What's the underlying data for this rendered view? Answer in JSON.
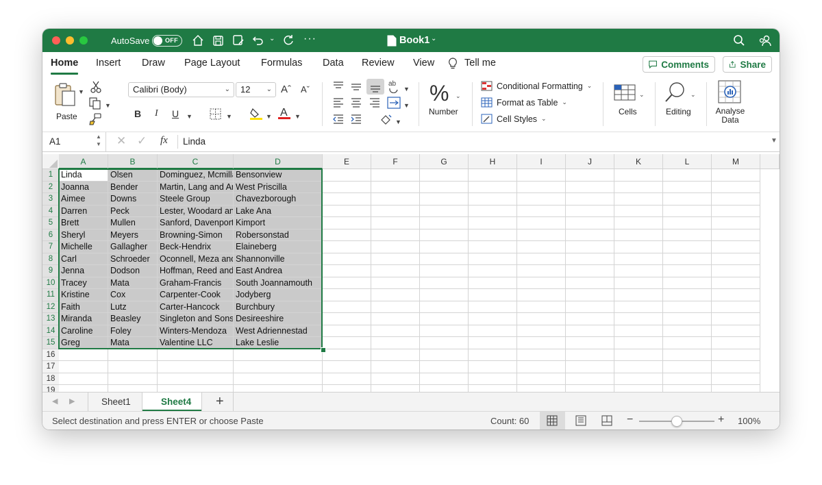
{
  "titlebar": {
    "autosave_label": "AutoSave",
    "toggle_label": "OFF",
    "doc_title": "Book1",
    "more": "···"
  },
  "tabs": [
    "Home",
    "Insert",
    "Draw",
    "Page Layout",
    "Formulas",
    "Data",
    "Review",
    "View"
  ],
  "tell_me": "Tell me",
  "comments_label": "Comments",
  "share_label": "Share",
  "ribbon": {
    "paste_label": "Paste",
    "font_name": "Calibri (Body)",
    "font_size": "12",
    "bold": "B",
    "italic": "I",
    "underline": "U",
    "number_label": "Number",
    "number_icon": "%",
    "cond_format": "Conditional Formatting",
    "format_table": "Format as Table",
    "cell_styles": "Cell Styles",
    "cells_label": "Cells",
    "editing_label": "Editing",
    "analyse_label": "Analyse",
    "analyse_label2": "Data"
  },
  "formula_bar": {
    "name_box": "A1",
    "fx": "fx",
    "value": "Linda"
  },
  "columns": [
    "A",
    "B",
    "C",
    "D",
    "E",
    "F",
    "G",
    "H",
    "I",
    "J",
    "K",
    "L",
    "M"
  ],
  "rows": [
    [
      "Linda",
      "Olsen",
      "Dominguez, Mcmillan and Donovan",
      "Bensonview"
    ],
    [
      "Joanna",
      "Bender",
      "Martin, Lang and Andrade",
      "West Priscilla"
    ],
    [
      "Aimee",
      "Downs",
      "Steele Group",
      "Chavezborough"
    ],
    [
      "Darren",
      "Peck",
      "Lester, Woodard and Mitchell",
      "Lake Ana"
    ],
    [
      "Brett",
      "Mullen",
      "Sanford, Davenport and Giles",
      "Kimport"
    ],
    [
      "Sheryl",
      "Meyers",
      "Browning-Simon",
      "Robersonstad"
    ],
    [
      "Michelle",
      "Gallagher",
      "Beck-Hendrix",
      "Elaineberg"
    ],
    [
      "Carl",
      "Schroeder",
      "Oconnell, Meza and Eaton",
      "Shannonville"
    ],
    [
      "Jenna",
      "Dodson",
      "Hoffman, Reed and Cox",
      "East Andrea"
    ],
    [
      "Tracey",
      "Mata",
      "Graham-Francis",
      "South Joannamouth"
    ],
    [
      "Kristine",
      "Cox",
      "Carpenter-Cook",
      "Jodyberg"
    ],
    [
      "Faith",
      "Lutz",
      "Carter-Hancock",
      "Burchbury"
    ],
    [
      "Miranda",
      "Beasley",
      "Singleton and Sons",
      "Desireeshire"
    ],
    [
      "Caroline",
      "Foley",
      "Winters-Mendoza",
      "West Adriennestad"
    ],
    [
      "Greg",
      "Mata",
      "Valentine LLC",
      "Lake Leslie"
    ]
  ],
  "row_numbers": [
    "1",
    "2",
    "3",
    "4",
    "5",
    "6",
    "7",
    "8",
    "9",
    "10",
    "11",
    "12",
    "13",
    "14",
    "15",
    "16",
    "17",
    "18",
    "19"
  ],
  "sheets": [
    "Sheet1",
    "Sheet4"
  ],
  "active_sheet": "Sheet4",
  "add_sheet": "+",
  "status": {
    "message": "Select destination and press ENTER or choose Paste",
    "count": "Count: 60",
    "zoom": "100%",
    "zoom_level": 1.0
  }
}
